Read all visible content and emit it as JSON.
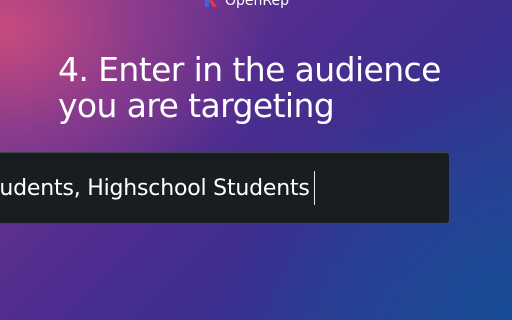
{
  "logo": {
    "name": "OpenRep",
    "icon": "openrep-logo-icon"
  },
  "prompt": {
    "line1": "4. Enter in the audience",
    "line2": "you are targeting"
  },
  "audience_input": {
    "value": "tudents, Highschool Students"
  },
  "colors": {
    "input_background": "#1a1d20",
    "text": "#ffffff",
    "logo_red": "#e03a4a",
    "logo_blue": "#3d63e8"
  }
}
